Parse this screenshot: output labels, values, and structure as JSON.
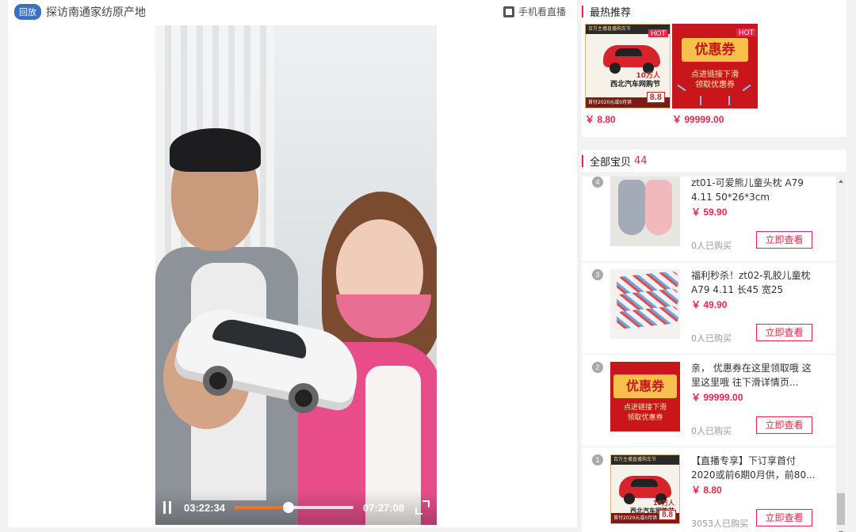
{
  "header": {
    "replay_badge": "回放",
    "title": "探访南通家纺原产地",
    "mobile_watch": "手机看直播"
  },
  "player": {
    "current_time": "03:22:34",
    "duration": "07:27:08",
    "progress": 0.453
  },
  "hot": {
    "title": "最热推荐",
    "items": [
      {
        "tag": "HOT",
        "price": "￥ 8.80",
        "image": {
          "band": "百万主播直播购车节",
          "brand_line1": "10万人",
          "brand_line2": "西北汽车网购节",
          "foot": "首付2020元或0月供",
          "discount": "8.8"
        }
      },
      {
        "tag": "HOT",
        "price": "￥ 99999.00",
        "image": {
          "coupon_title": "优惠券",
          "coupon_sub1": "点进链接下滑",
          "coupon_sub2": "领取优惠券"
        }
      }
    ]
  },
  "all": {
    "title": "全部宝贝",
    "count": "44",
    "items": [
      {
        "index": "4",
        "name": "zt01-可爱熊儿童头枕 A79 4.11 50*26*3cm",
        "price": "￥ 59.90",
        "sold": "0人已购买",
        "view_label": "立即查看",
        "thumb": "pillow-image"
      },
      {
        "index": "3",
        "name": "福利秒杀！zt02-乳胶儿童枕 A79 4.11 长45 宽25",
        "price": "￥ 49.90",
        "sold": "0人已购买",
        "view_label": "立即查看",
        "thumb": "latex-pillow-image"
      },
      {
        "index": "2",
        "name": "亲， 优惠券在这里领取哦 这里这里哦 往下滑详情页...",
        "price": "￥ 99999.00",
        "sold": "0人已购买",
        "view_label": "立即查看",
        "thumb": "coupon-image"
      },
      {
        "index": "1",
        "name": "【直播专享】下订享首付2020或前6期0月供，前80...",
        "price": "￥ 8.80",
        "sold": "3053人已购买",
        "view_label": "立即查看",
        "thumb": "car-image"
      }
    ]
  },
  "colors": {
    "accent": "#e8264a",
    "badge_blue": "#3a6fc4",
    "progress": "#ff6a2b"
  }
}
